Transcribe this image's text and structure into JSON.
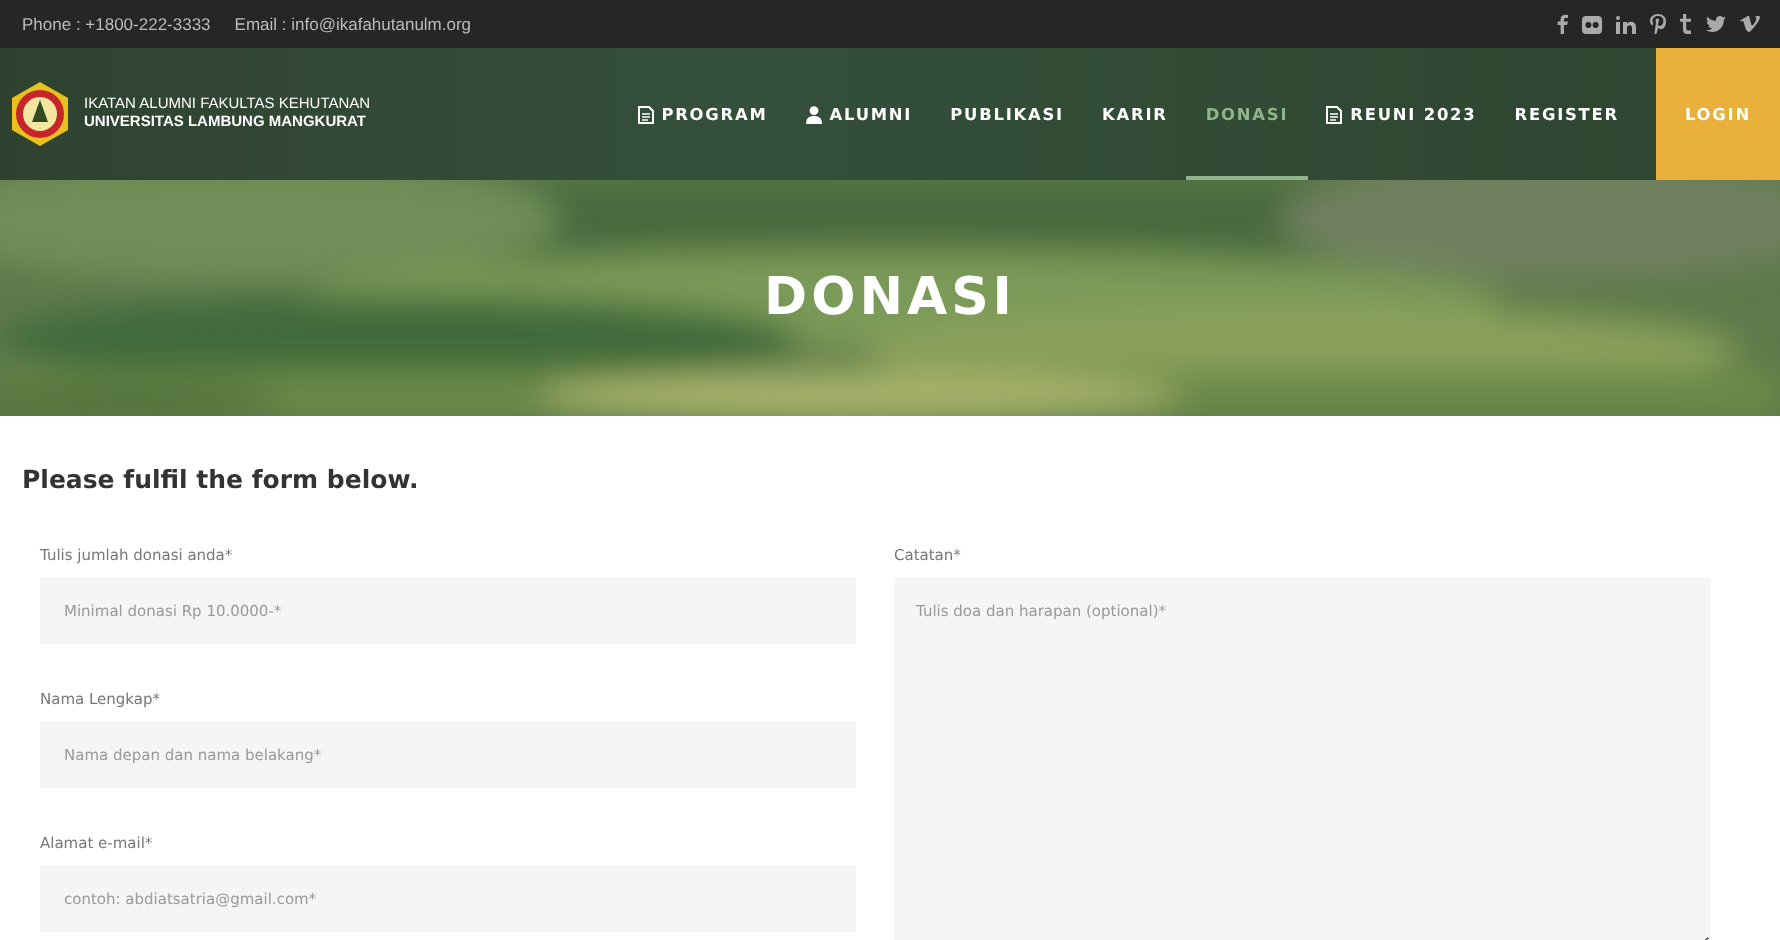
{
  "topbar": {
    "phone": "Phone : +1800-222-3333",
    "email": "Email : info@ikafahutanulm.org"
  },
  "brand": {
    "line1": "IKATAN ALUMNI FAKULTAS KEHUTANAN",
    "line2": "UNIVERSITAS LAMBUNG MANGKURAT"
  },
  "nav": [
    {
      "label": "PROGRAM",
      "selected": false
    },
    {
      "label": "ALUMNI",
      "selected": false
    },
    {
      "label": "PUBLIKASI",
      "selected": false
    },
    {
      "label": "KARIR",
      "selected": false
    },
    {
      "label": "DONASI",
      "selected": true
    },
    {
      "label": "REUNI 2023",
      "selected": false
    },
    {
      "label": "REGISTER",
      "selected": false
    }
  ],
  "login": "LOGIN",
  "hero": {
    "title": "DONASI",
    "kind": "picture"
  },
  "form": {
    "heading": "Please fulfil the form below.",
    "left": [
      {
        "label": "Tulis jumlah donasi anda*",
        "placeholder": "Minimal donasi Rp 10.0000-*"
      },
      {
        "label": "Nama Lengkap*",
        "placeholder": "Nama depan dan nama belakang*"
      },
      {
        "label": "Alamat e-mail*",
        "placeholder": "contoh: abdiatsatria@gmail.com*"
      }
    ],
    "right": {
      "label": "Catatan*",
      "placeholder": "Tulis doa dan harapan (optional)*"
    }
  }
}
